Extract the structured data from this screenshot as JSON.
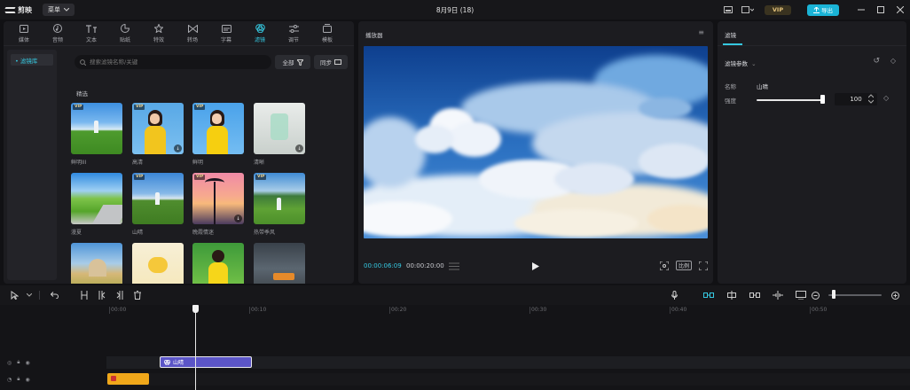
{
  "app": {
    "name": "剪映",
    "menu_label": "菜单",
    "project_title": "8月9日 (18)",
    "vip_label": "VIP",
    "export_label": "导出"
  },
  "tabs": [
    {
      "label": "媒体",
      "icon": "media-icon"
    },
    {
      "label": "音频",
      "icon": "audio-icon"
    },
    {
      "label": "文本",
      "icon": "text-icon"
    },
    {
      "label": "贴纸",
      "icon": "sticker-icon"
    },
    {
      "label": "特效",
      "icon": "effects-icon"
    },
    {
      "label": "转场",
      "icon": "transition-icon"
    },
    {
      "label": "字幕",
      "icon": "subtitle-icon"
    },
    {
      "label": "滤镜",
      "icon": "filter-icon",
      "active": true
    },
    {
      "label": "调节",
      "icon": "adjust-icon"
    },
    {
      "label": "模板",
      "icon": "template-icon"
    }
  ],
  "sidebar": {
    "items": [
      {
        "label": "• 滤镜库"
      }
    ]
  },
  "search": {
    "placeholder": "搜索滤镜名称/关键"
  },
  "filter_chips": {
    "all_label": "全部",
    "sync_label": "同步"
  },
  "section": {
    "label": "精选"
  },
  "filters": [
    {
      "name": "鲜明III",
      "vip": true,
      "download": false
    },
    {
      "name": "高清",
      "vip": true,
      "download": true
    },
    {
      "name": "鲜明",
      "vip": true,
      "download": false
    },
    {
      "name": "清晰",
      "vip": false,
      "download": true
    },
    {
      "name": "漫夏",
      "vip": false,
      "download": false
    },
    {
      "name": "山晴",
      "vip": true,
      "download": false
    },
    {
      "name": "晚霞情迷",
      "vip": true,
      "download": true
    },
    {
      "name": "热带季风",
      "vip": true,
      "download": false
    },
    {
      "name": "",
      "vip": false,
      "download": false
    },
    {
      "name": "",
      "vip": false,
      "download": false
    },
    {
      "name": "",
      "vip": false,
      "download": false
    },
    {
      "name": "",
      "vip": false,
      "download": false
    }
  ],
  "player": {
    "title": "播放器",
    "current_time": "00:00:06:09",
    "total_time": "00:00:20:00",
    "ratio_label": "比例"
  },
  "properties": {
    "tab_label": "滤镜",
    "section_label": "滤镜参数",
    "name_label": "名称",
    "name_value": "山晴",
    "strength_label": "强度",
    "strength_value": "100",
    "strength_fraction": 1.0
  },
  "timeline": {
    "ruler": [
      "00:00",
      "00:10",
      "00:20",
      "00:30",
      "00:40",
      "00:50"
    ],
    "filter_clip_label": "山晴"
  }
}
